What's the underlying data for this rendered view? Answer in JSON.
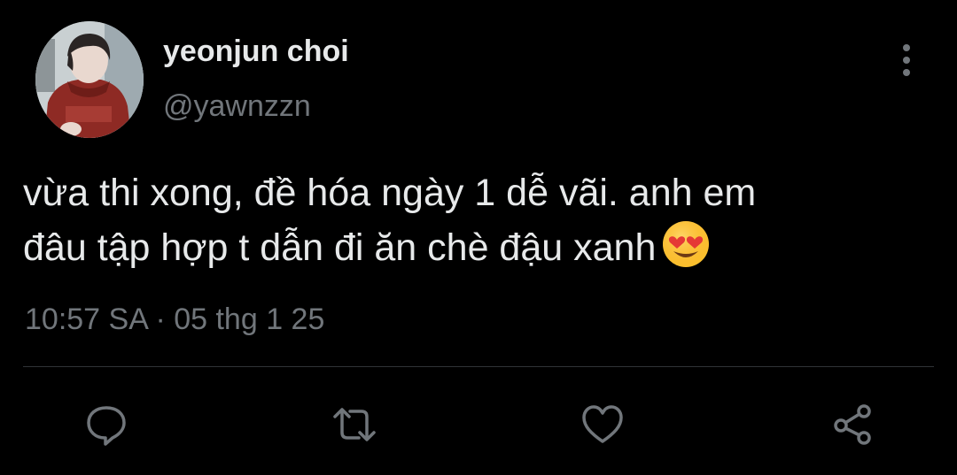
{
  "user": {
    "display_name": "yeonjun choi",
    "handle": "@yawnzzn",
    "avatar_icon": "profile-photo"
  },
  "tweet": {
    "text_line1": "vừa thi xong, đề hóa ngày 1 dễ vãi. anh em",
    "text_line2": "đâu tập hợp t dẫn đi ăn chè đậu xanh",
    "emoji": "heart-eyes-emoji",
    "timestamp": "10:57 SA · 05 thg 1 25"
  },
  "actions": [
    {
      "icon": "reply-icon"
    },
    {
      "icon": "retweet-icon"
    },
    {
      "icon": "like-icon"
    },
    {
      "icon": "share-icon"
    }
  ],
  "colors": {
    "background": "#000000",
    "text": "#e7e9ea",
    "secondary": "#71767b",
    "divider": "#2f3336"
  }
}
